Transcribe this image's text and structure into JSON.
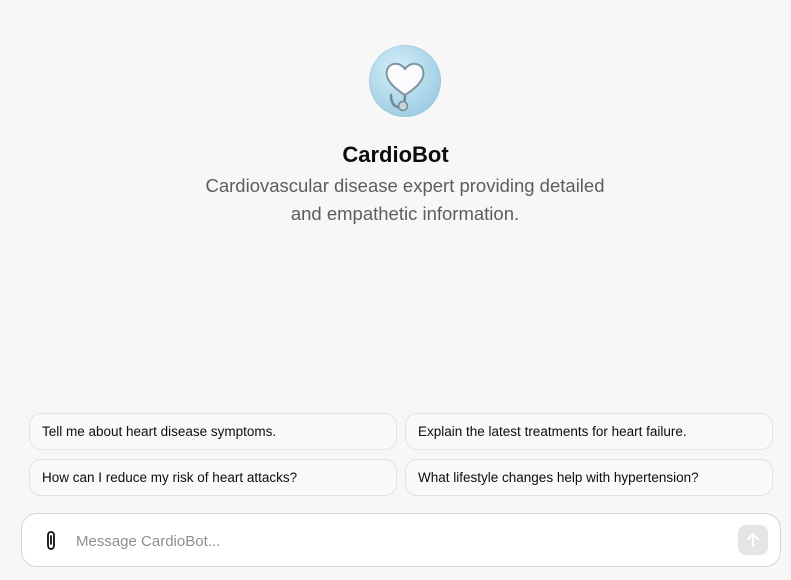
{
  "bot": {
    "name": "CardioBot",
    "description_line1": "Cardiovascular disease expert providing detailed",
    "description_line2": "and empathetic information.",
    "avatar_icon": "heart-stethoscope-icon"
  },
  "suggestions": [
    {
      "label": "Tell me about heart disease symptoms."
    },
    {
      "label": "Explain the latest treatments for heart failure."
    },
    {
      "label": "How can I reduce my risk of heart attacks?"
    },
    {
      "label": "What lifestyle changes help with hypertension?"
    }
  ],
  "composer": {
    "placeholder": "Message CardioBot...",
    "attach_icon": "paperclip-icon",
    "send_icon": "arrow-up-icon"
  },
  "colors": {
    "background": "#f7f7f7",
    "avatar_bg": "#a9d4e8",
    "description_text": "#5d5d5d",
    "send_button_disabled": "#e5e5e5"
  }
}
